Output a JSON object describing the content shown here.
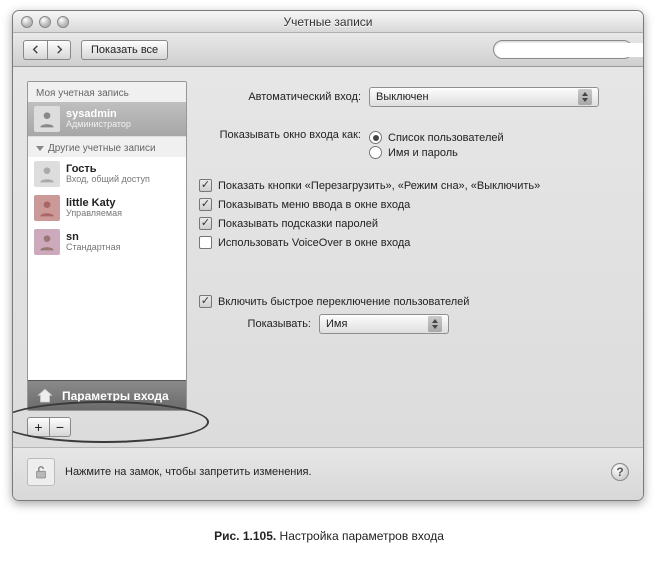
{
  "window": {
    "title": "Учетные записи"
  },
  "toolbar": {
    "show_all": "Показать все",
    "search_placeholder": ""
  },
  "sidebar": {
    "my_account_header": "Моя учетная запись",
    "other_accounts_header": "Другие учетные записи",
    "login_options_label": "Параметры входа",
    "accounts": [
      {
        "name": "sysadmin",
        "role": "Администратор"
      },
      {
        "name": "Гость",
        "role": "Вход, общий доступ"
      },
      {
        "name": "little Katy",
        "role": "Управляемая"
      },
      {
        "name": "sn",
        "role": "Стандартная"
      }
    ],
    "add": "+",
    "remove": "−"
  },
  "main": {
    "auto_login_label": "Автоматический вход:",
    "auto_login_value": "Выключен",
    "display_as_label": "Показывать окно входа как:",
    "radio_list": "Список пользователей",
    "radio_namepw": "Имя и пароль",
    "chk_restart": "Показать кнопки «Перезагрузить», «Режим сна», «Выключить»",
    "chk_menu": "Показывать меню ввода в окне входа",
    "chk_hints": "Показывать подсказки паролей",
    "chk_voiceover": "Использовать VoiceOver в окне входа",
    "chk_fastswitch": "Включить быстрое переключение пользователей",
    "fastswitch_show_label": "Показывать:",
    "fastswitch_show_value": "Имя"
  },
  "footer": {
    "lock_text": "Нажмите на замок, чтобы запретить изменения."
  },
  "caption": {
    "ref": "Рис. 1.105.",
    "text": "Настройка параметров входа"
  }
}
